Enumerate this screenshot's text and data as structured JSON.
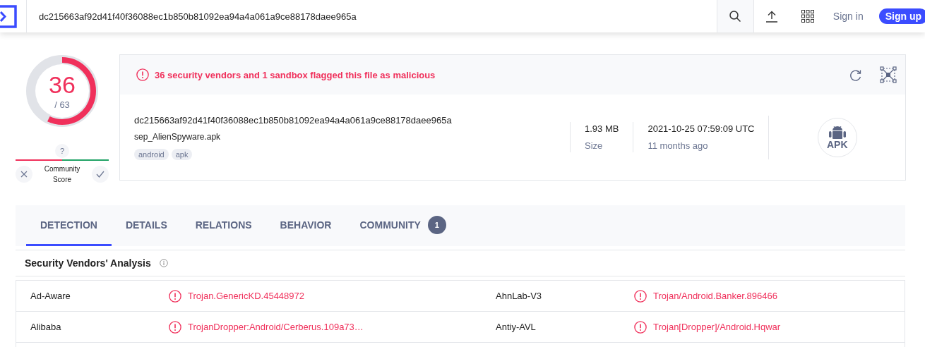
{
  "header": {
    "search_value": "dc215663af92d41f40f36088ec1b850b81092ea94a4a061a9ce88178daee965a",
    "sign_in": "Sign in",
    "sign_up": "Sign up"
  },
  "score": {
    "detections": "36",
    "total": "/ 63",
    "level": 0.571
  },
  "community": {
    "badge": "?",
    "label": "Community Score"
  },
  "alert": "36 security vendors and 1 sandbox flagged this file as malicious",
  "file": {
    "hash": "dc215663af92d41f40f36088ec1b850b81092ea94a4a061a9ce88178daee965a",
    "name": "sep_AlienSpyware.apk",
    "tags": [
      "android",
      "apk"
    ],
    "size": "1.93 MB",
    "size_label": "Size",
    "date": "2021-10-25 07:59:09 UTC",
    "age": "11 months ago",
    "type": "APK"
  },
  "tabs": [
    {
      "label": "DETECTION",
      "selected": true
    },
    {
      "label": "DETAILS",
      "selected": false
    },
    {
      "label": "RELATIONS",
      "selected": false
    },
    {
      "label": "BEHAVIOR",
      "selected": false
    },
    {
      "label": "COMMUNITY",
      "selected": false,
      "count": "1"
    }
  ],
  "section_title": "Security Vendors' Analysis",
  "rows": [
    [
      {
        "vendor": "Ad-Aware",
        "result": "Trojan.GenericKD.45448972"
      },
      {
        "vendor": "AhnLab-V3",
        "result": "Trojan/Android.Banker.896466"
      }
    ],
    [
      {
        "vendor": "Alibaba",
        "result": "TrojanDropper:Android/Cerberus.109a73…"
      },
      {
        "vendor": "Antiy-AVL",
        "result": "Trojan[Dropper]/Android.Hqwar"
      }
    ]
  ]
}
